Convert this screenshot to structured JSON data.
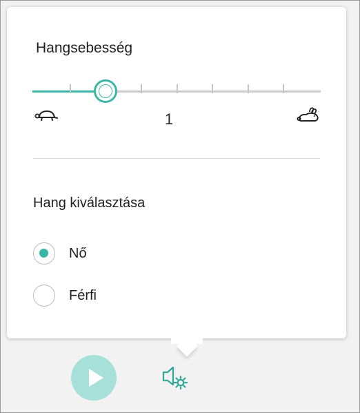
{
  "speed": {
    "title": "Hangsebesség",
    "value_label": "1",
    "slider_level_fraction": 0.25,
    "tick_count": 7,
    "slow_icon": "turtle-icon",
    "fast_icon": "rabbit-icon"
  },
  "voice": {
    "title": "Hang kiválasztása",
    "options": [
      {
        "label": "Nő",
        "selected": true
      },
      {
        "label": "Férfi",
        "selected": false
      }
    ]
  },
  "controls": {
    "play_icon": "play-icon",
    "voice_settings_icon": "voice-settings-icon"
  },
  "colors": {
    "accent": "#3cb6a7",
    "play_button_bg": "#a6e1d9",
    "track": "#cccccc"
  }
}
